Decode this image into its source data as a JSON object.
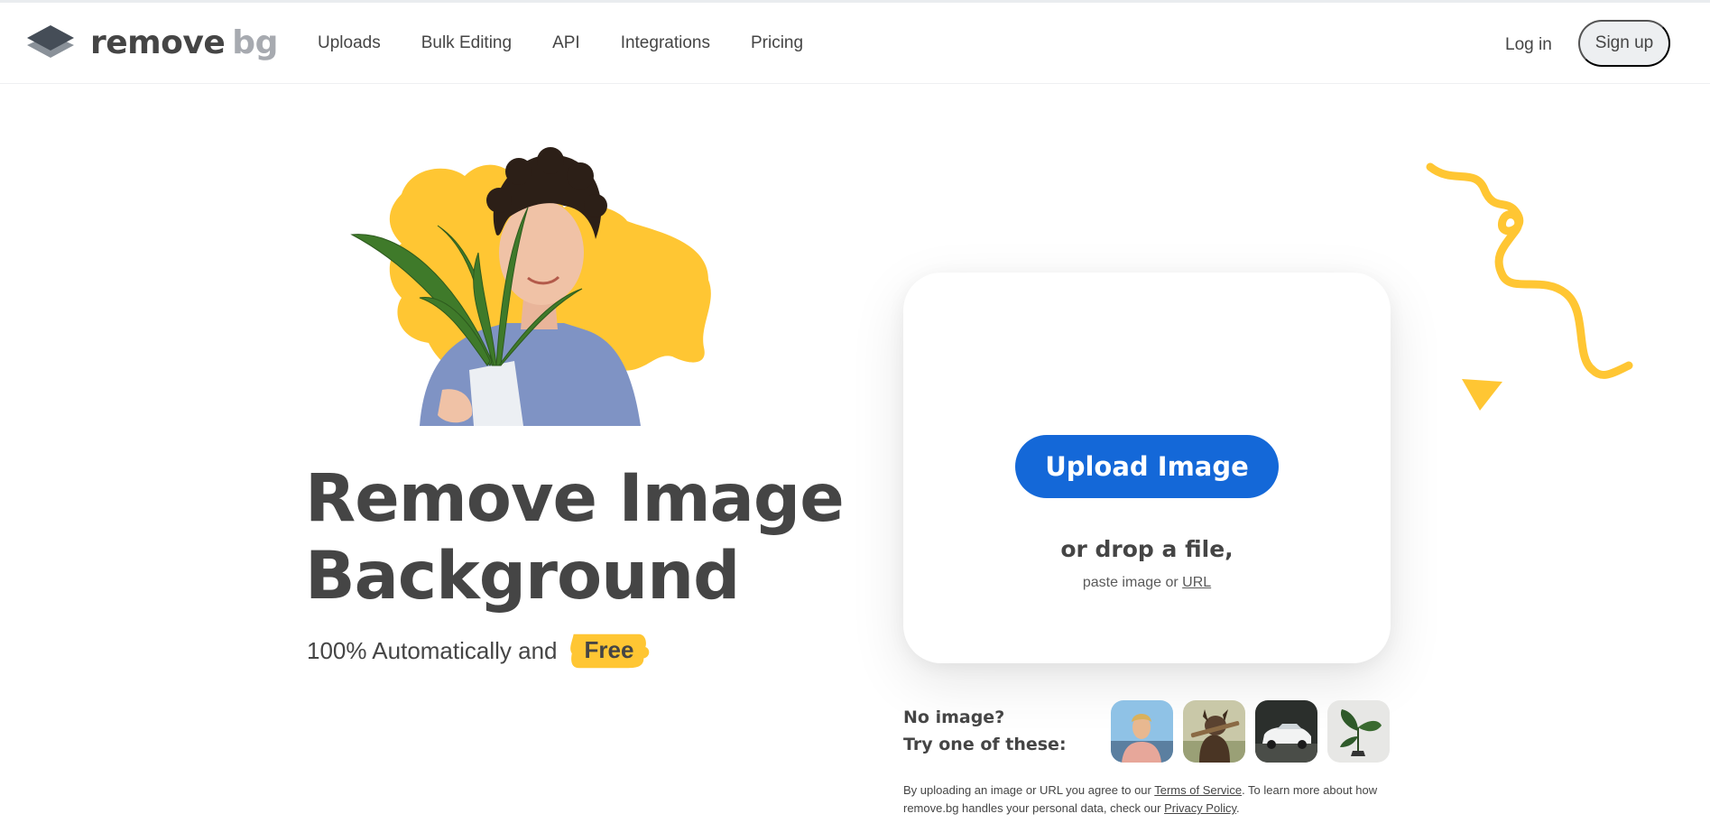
{
  "brand": {
    "name_main": "remove",
    "name_accent": "bg"
  },
  "nav": {
    "items": [
      {
        "label": "Uploads"
      },
      {
        "label": "Bulk Editing"
      },
      {
        "label": "API"
      },
      {
        "label": "Integrations"
      },
      {
        "label": "Pricing"
      }
    ],
    "login_label": "Log in",
    "signup_label": "Sign up"
  },
  "hero": {
    "title_line1": "Remove Image",
    "title_line2": "Background",
    "subtitle": "100% Automatically and",
    "badge": "Free"
  },
  "upload": {
    "button_label": "Upload Image",
    "drop_text": "or drop a file,",
    "paste_prefix": "paste image or",
    "paste_link": "URL"
  },
  "samples": {
    "heading_line1": "No image?",
    "heading_line2": "Try one of these:",
    "items": [
      {
        "icon": "person-thumbnail"
      },
      {
        "icon": "dog-thumbnail"
      },
      {
        "icon": "car-thumbnail"
      },
      {
        "icon": "plant-thumbnail"
      }
    ]
  },
  "legal": {
    "part1": "By uploading an image or URL you agree to our",
    "terms_link": "Terms of Service",
    "part2": ". To learn more about how remove.bg handles your personal data, check our",
    "privacy_link": "Privacy Policy",
    "part3": "."
  },
  "colors": {
    "primary": "#1468d8",
    "accent_yellow": "#ffc633",
    "text": "#454545",
    "logo_gray": "#a7aab0"
  }
}
